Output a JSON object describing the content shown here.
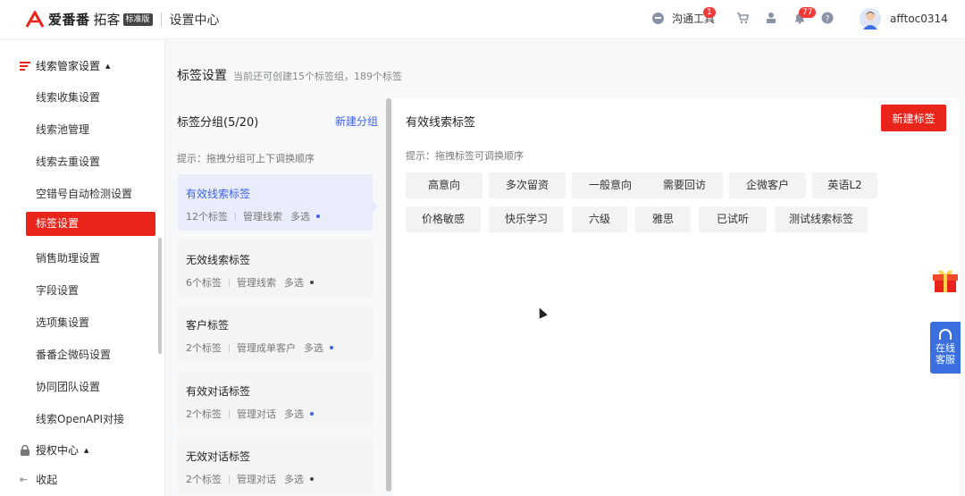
{
  "header": {
    "brand_name": "爱番番",
    "brand_sub": "拓客",
    "edition": "标准版",
    "app_title": "设置中心",
    "chat_tool_label": "沟通工具",
    "chat_badge": "1",
    "notice_badge": "77",
    "username": "afftoc0314"
  },
  "sidebar": {
    "group1_label": "线索管家设置",
    "items": [
      {
        "label": "线索收集设置"
      },
      {
        "label": "线索池管理"
      },
      {
        "label": "线索去重设置"
      },
      {
        "label": "空错号自动检测设置"
      },
      {
        "label": "标签设置"
      },
      {
        "label": "销售助理设置"
      },
      {
        "label": "字段设置"
      },
      {
        "label": "选项集设置"
      },
      {
        "label": "番番企微码设置"
      },
      {
        "label": "协同团队设置"
      },
      {
        "label": "线索OpenAPI对接"
      }
    ],
    "group2_label": "授权中心",
    "collapse_label": "收起"
  },
  "page": {
    "title": "标签设置",
    "hint": "当前还可创建15个标签组，189个标签"
  },
  "groups": {
    "heading": "标签分组(5/20)",
    "new_group": "新建分组",
    "tip": "提示：拖拽分组可上下调换顺序",
    "list": [
      {
        "name": "有效线索标签",
        "count": "12个标签",
        "manage": "管理线索",
        "mode": "多选"
      },
      {
        "name": "无效线索标签",
        "count": "6个标签",
        "manage": "管理线索",
        "mode": "多选"
      },
      {
        "name": "客户标签",
        "count": "2个标签",
        "manage": "管理成单客户",
        "mode": "多选"
      },
      {
        "name": "有效对话标签",
        "count": "2个标签",
        "manage": "管理对话",
        "mode": "多选"
      },
      {
        "name": "无效对话标签",
        "count": "2个标签",
        "manage": "管理对话",
        "mode": "多选"
      }
    ]
  },
  "tags": {
    "heading": "有效线索标签",
    "new_tag": "新建标签",
    "tip": "提示：拖拽标签可调换顺序",
    "items": [
      "高意向",
      "多次留资",
      "一般意向",
      "需要回访",
      "企微客户",
      "英语L2",
      "价格敏感",
      "快乐学习",
      "六级",
      "雅思",
      "已试听",
      "测试线索标签"
    ]
  },
  "float": {
    "service_line1": "在线",
    "service_line2": "客服"
  },
  "colors": {
    "accent_red": "#e8241b",
    "link_blue": "#3f63e0",
    "service_blue": "#3b6fe0"
  }
}
